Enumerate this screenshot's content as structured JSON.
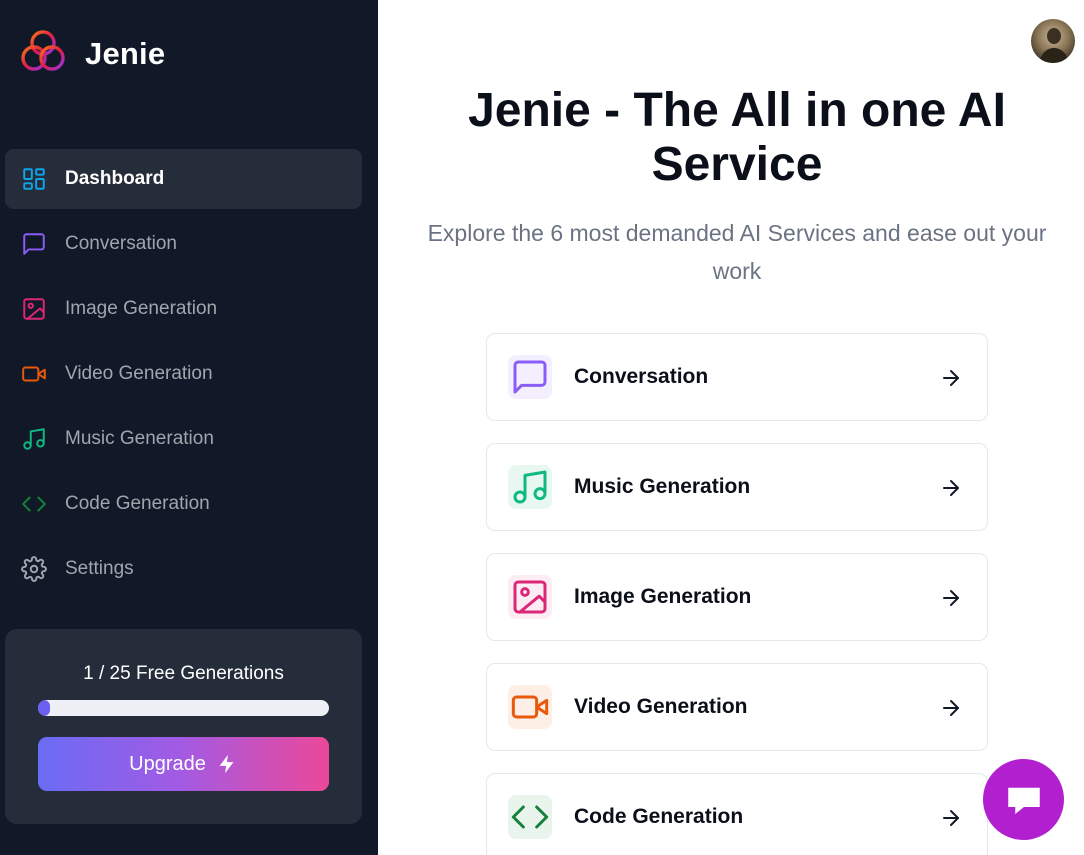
{
  "brand": {
    "name": "Jenie",
    "logo_icon": "trefoil-logo-icon"
  },
  "sidebar": {
    "items": [
      {
        "label": "Dashboard",
        "icon": "dashboard-icon",
        "color": "#0ea5e9",
        "active": true
      },
      {
        "label": "Conversation",
        "icon": "message-square-icon",
        "color": "#8b5cf6"
      },
      {
        "label": "Image Generation",
        "icon": "image-icon",
        "color": "#db2777"
      },
      {
        "label": "Video Generation",
        "icon": "video-icon",
        "color": "#ea580c"
      },
      {
        "label": "Music Generation",
        "icon": "music-icon",
        "color": "#10b981"
      },
      {
        "label": "Code Generation",
        "icon": "code-icon",
        "color": "#15803d"
      },
      {
        "label": "Settings",
        "icon": "gear-icon",
        "color": "#a1a5ad"
      }
    ]
  },
  "quota": {
    "text": "1 / 25 Free Generations",
    "used": 1,
    "total": 25
  },
  "upgrade": {
    "label": "Upgrade",
    "icon": "zap-icon"
  },
  "hero": {
    "title_line1": "Jenie - The All in one AI",
    "title_line2": "Service",
    "subtitle_line1": "Explore the 6 most demanded AI Services and ease out your",
    "subtitle_line2": "work"
  },
  "cards": [
    {
      "label": "Conversation",
      "icon": "message-square-icon",
      "color": "#8b5cf6",
      "bg": "#f3effe"
    },
    {
      "label": "Music Generation",
      "icon": "music-icon",
      "color": "#10b981",
      "bg": "#e8f8f1"
    },
    {
      "label": "Image Generation",
      "icon": "image-icon",
      "color": "#db2777",
      "bg": "#fcecf3"
    },
    {
      "label": "Video Generation",
      "icon": "video-icon",
      "color": "#ea580c",
      "bg": "#fdefe6"
    },
    {
      "label": "Code Generation",
      "icon": "code-icon",
      "color": "#15803d",
      "bg": "#e9f4ec"
    }
  ],
  "colors": {
    "sidebar_bg": "#111827",
    "active_item_bg": "#252c3a",
    "chat_fab": "#b11fcf"
  },
  "chat": {
    "icon": "chat-bubble-icon"
  },
  "user": {
    "avatar": "user-avatar"
  }
}
